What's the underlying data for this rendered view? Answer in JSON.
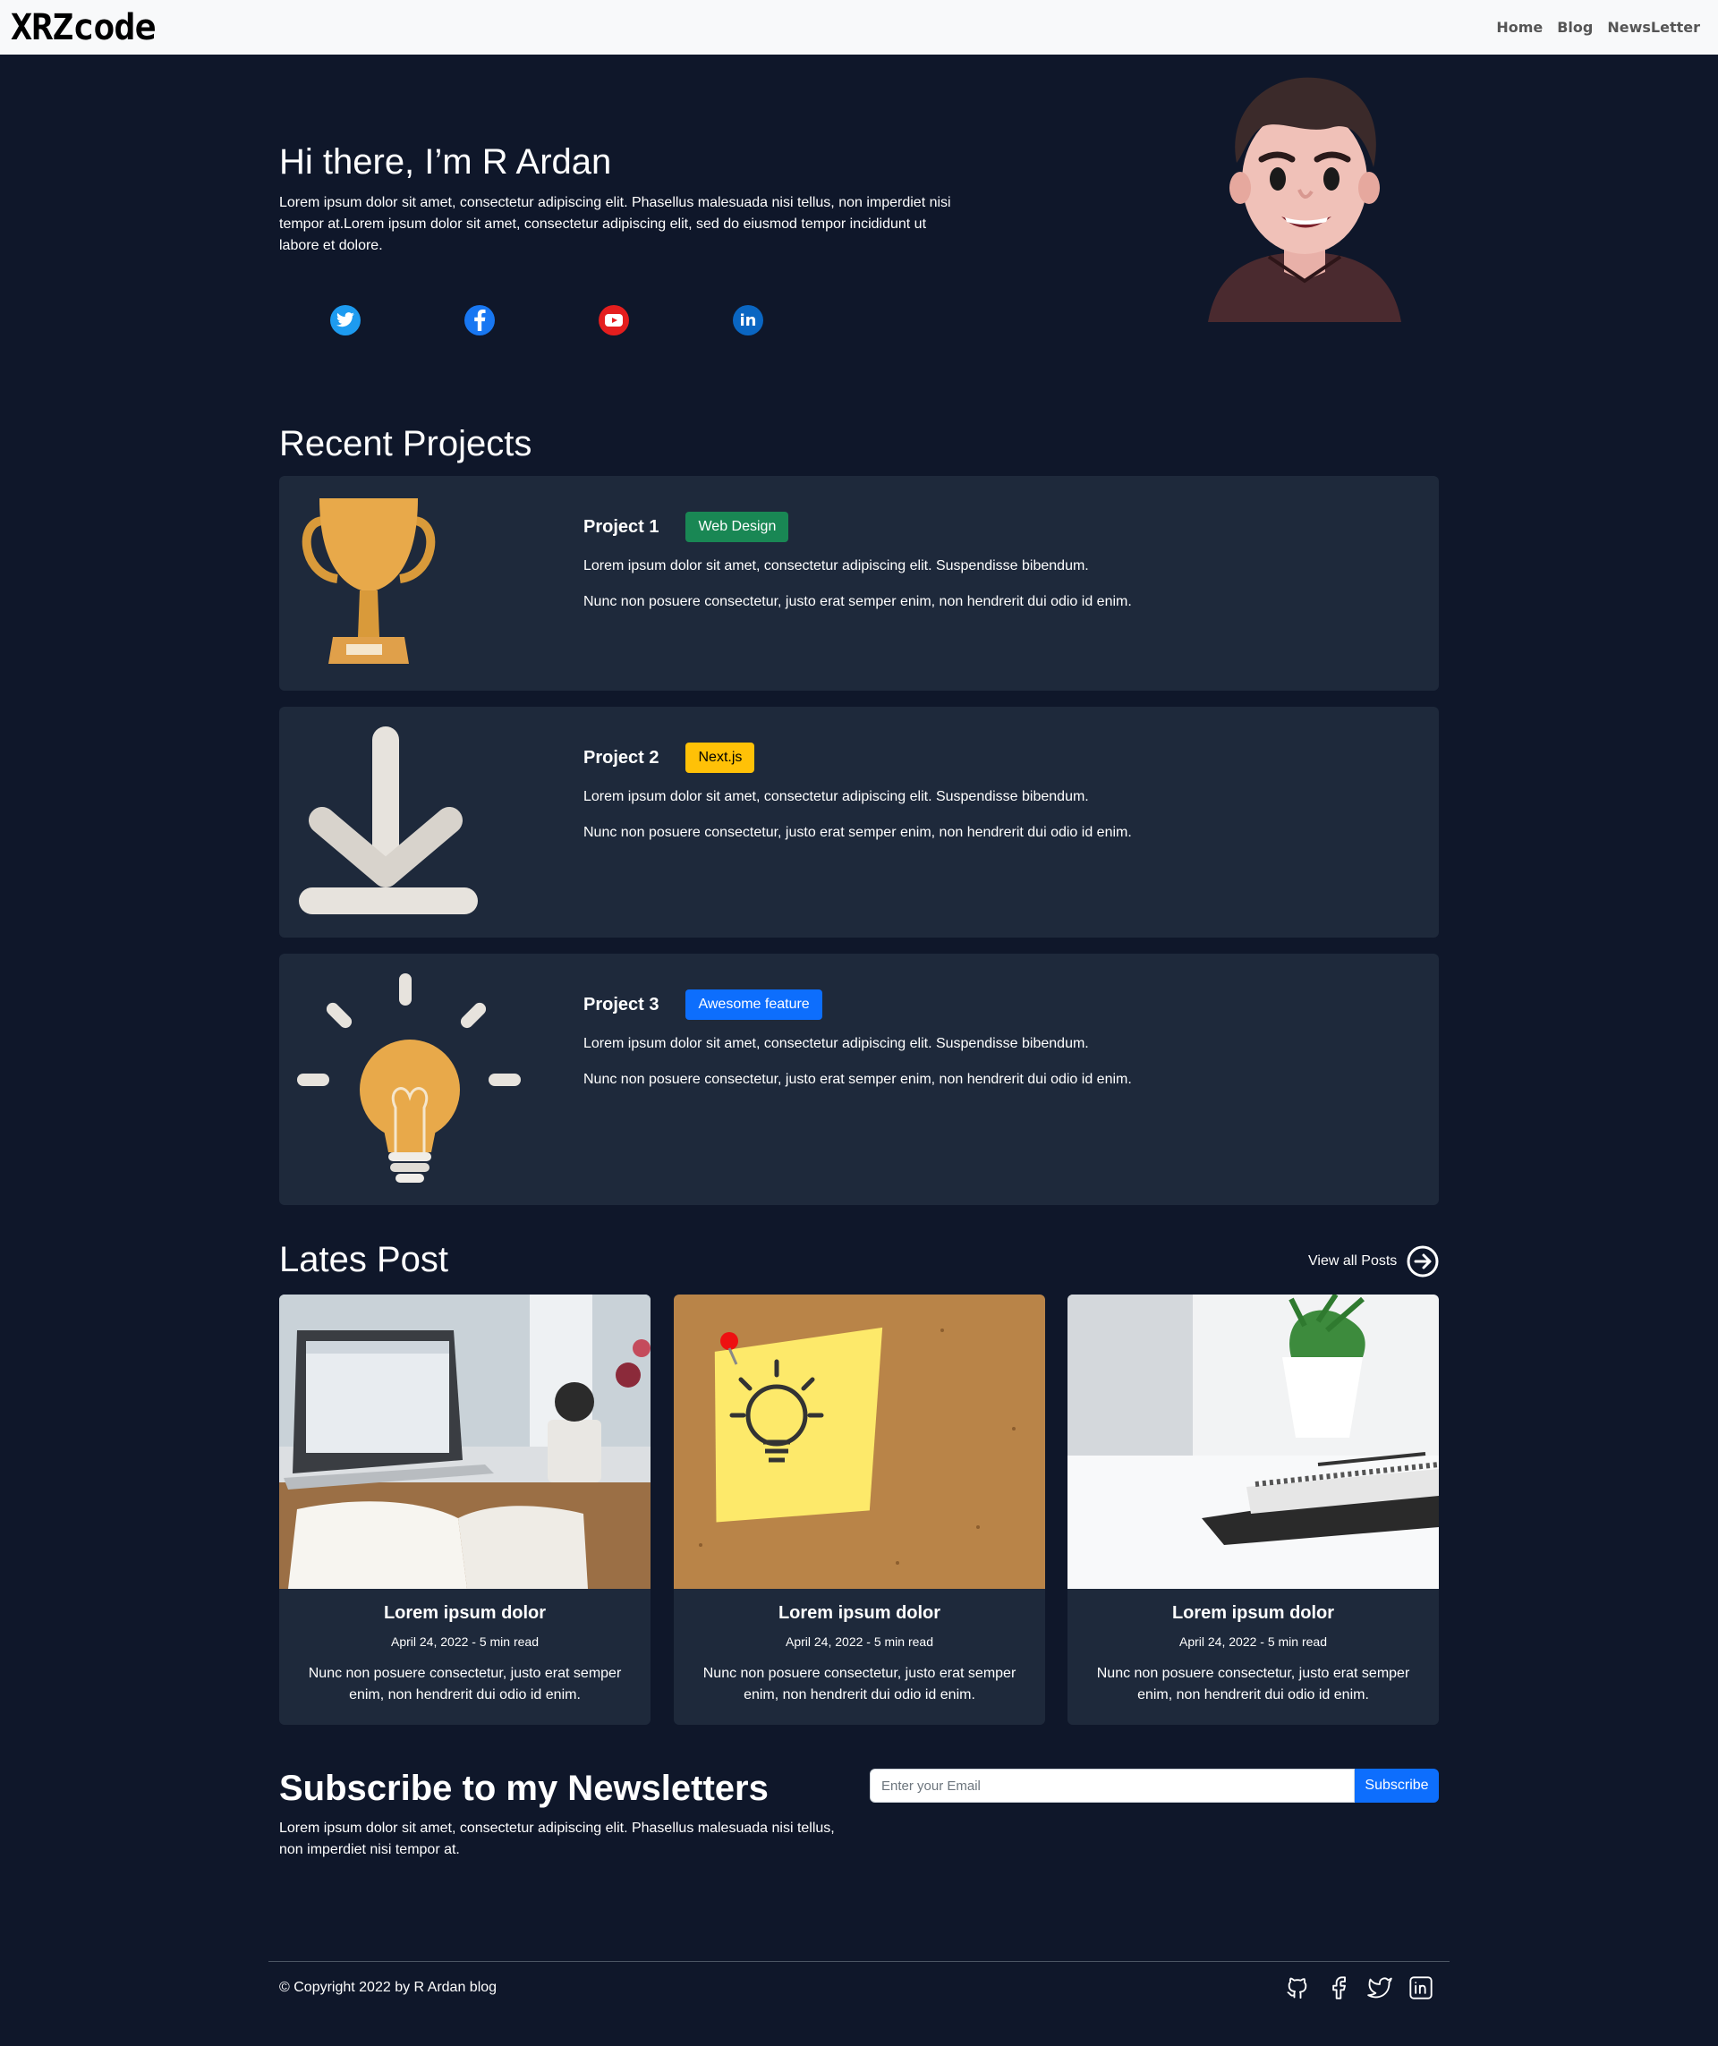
{
  "brand": "XRZcode",
  "nav": {
    "items": [
      {
        "label": "Home"
      },
      {
        "label": "Blog"
      },
      {
        "label": "NewsLetter"
      }
    ]
  },
  "hero": {
    "title": "Hi there, I’m R Ardan",
    "description": "Lorem ipsum dolor sit amet, consectetur adipiscing elit. Phasellus malesuada nisi tellus, non imperdiet nisi tempor at.Lorem ipsum dolor sit amet, consectetur adipiscing elit, sed do eiusmod tempor incididunt ut labore et dolore.",
    "socials": [
      "twitter-icon",
      "facebook-icon",
      "youtube-icon",
      "linkedin-icon"
    ]
  },
  "projects": {
    "title": "Recent Projects",
    "items": [
      {
        "name": "Project 1",
        "badge": "Web Design",
        "badge_color": "#198754",
        "line1": "Lorem ipsum dolor sit amet, consectetur adipiscing elit. Suspendisse bibendum.",
        "line2": "Nunc non posuere consectetur, justo erat semper enim, non hendrerit dui odio id enim.",
        "icon": "trophy-icon"
      },
      {
        "name": "Project 2",
        "badge": "Next.js",
        "badge_color": "#ffc107",
        "line1": "Lorem ipsum dolor sit amet, consectetur adipiscing elit. Suspendisse bibendum.",
        "line2": "Nunc non posuere consectetur, justo erat semper enim, non hendrerit dui odio id enim.",
        "icon": "download-icon"
      },
      {
        "name": "Project 3",
        "badge": "Awesome feature",
        "badge_color": "#0d6efd",
        "line1": "Lorem ipsum dolor sit amet, consectetur adipiscing elit. Suspendisse bibendum.",
        "line2": "Nunc non posuere consectetur, justo erat semper enim, non hendrerit dui odio id enim.",
        "icon": "lightbulb-icon"
      }
    ]
  },
  "posts": {
    "title": "Lates Post",
    "view_all": "View all Posts",
    "items": [
      {
        "title": "Lorem ipsum dolor",
        "meta": "April 24, 2022 - 5 min read",
        "text": "Nunc non posuere consectetur, justo erat semper enim, non hendrerit dui odio id enim."
      },
      {
        "title": "Lorem ipsum dolor",
        "meta": "April 24, 2022 - 5 min read",
        "text": "Nunc non posuere consectetur, justo erat semper enim, non hendrerit dui odio id enim."
      },
      {
        "title": "Lorem ipsum dolor",
        "meta": "April 24, 2022 - 5 min read",
        "text": "Nunc non posuere consectetur, justo erat semper enim, non hendrerit dui odio id enim."
      }
    ]
  },
  "newsletter": {
    "title": "Subscribe to my Newsletters",
    "text": "Lorem ipsum dolor sit amet, consectetur adipiscing elit. Phasellus malesuada nisi tellus, non imperdiet nisi tempor at.",
    "placeholder": "Enter your Email",
    "value": "",
    "button": "Subscribe"
  },
  "footer": {
    "copyright": "© Copyright 2022 by R Ardan blog",
    "icons": [
      "github-icon",
      "facebook-icon",
      "twitter-icon",
      "linkedin-icon"
    ]
  },
  "colors": {
    "background": "#0f172a",
    "card": "#1e293b",
    "primary": "#0d6efd"
  }
}
